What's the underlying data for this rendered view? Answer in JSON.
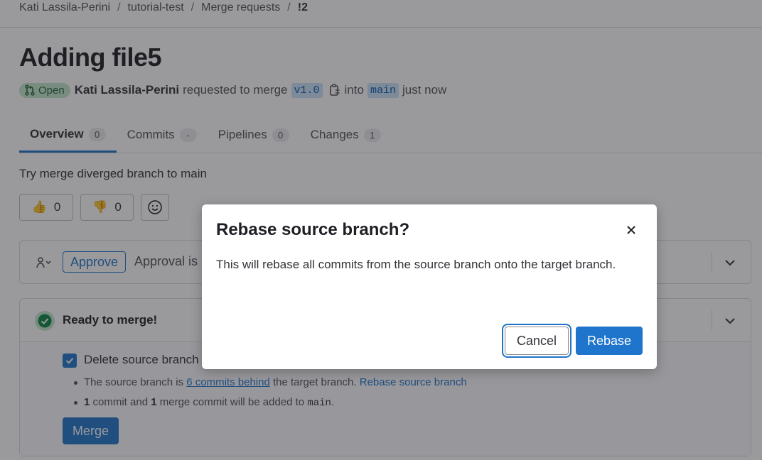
{
  "breadcrumb": {
    "items": [
      "Kati Lassila-Perini",
      "tutorial-test",
      "Merge requests",
      "!2"
    ]
  },
  "mr": {
    "title": "Adding file5",
    "status": "Open",
    "author": "Kati Lassila-Perini",
    "action": "requested to merge",
    "source_branch": "v1.0",
    "into": "into",
    "target_branch": "main",
    "time": "just now",
    "description": "Try merge diverged branch to main"
  },
  "tabs": [
    {
      "label": "Overview",
      "count": "0"
    },
    {
      "label": "Commits",
      "count": "-"
    },
    {
      "label": "Pipelines",
      "count": "0"
    },
    {
      "label": "Changes",
      "count": "1"
    }
  ],
  "reactions": {
    "thumbsup": "0",
    "thumbsdown": "0"
  },
  "approval": {
    "button": "Approve",
    "text": "Approval is"
  },
  "merge_widget": {
    "title": "Ready to merge!",
    "delete_label": "Delete source branch",
    "line1_pre": "The source branch is ",
    "line1_link": "6 commits behind",
    "line1_mid": " the target branch. ",
    "line1_action": "Rebase source branch",
    "line2_n1": "1",
    "line2_a": " commit and ",
    "line2_n2": "1",
    "line2_b": " merge commit will be added to ",
    "line2_branch": "main",
    "line2_end": ".",
    "merge_button": "Merge"
  },
  "modal": {
    "title": "Rebase source branch?",
    "body": "This will rebase all commits from the source branch onto the target branch.",
    "cancel": "Cancel",
    "confirm": "Rebase"
  },
  "colors": {
    "primary": "#1f75cb",
    "success_bg": "#c3e6cd",
    "success_fg": "#24663b",
    "overlay": "rgba(31,30,36,0.45)"
  }
}
